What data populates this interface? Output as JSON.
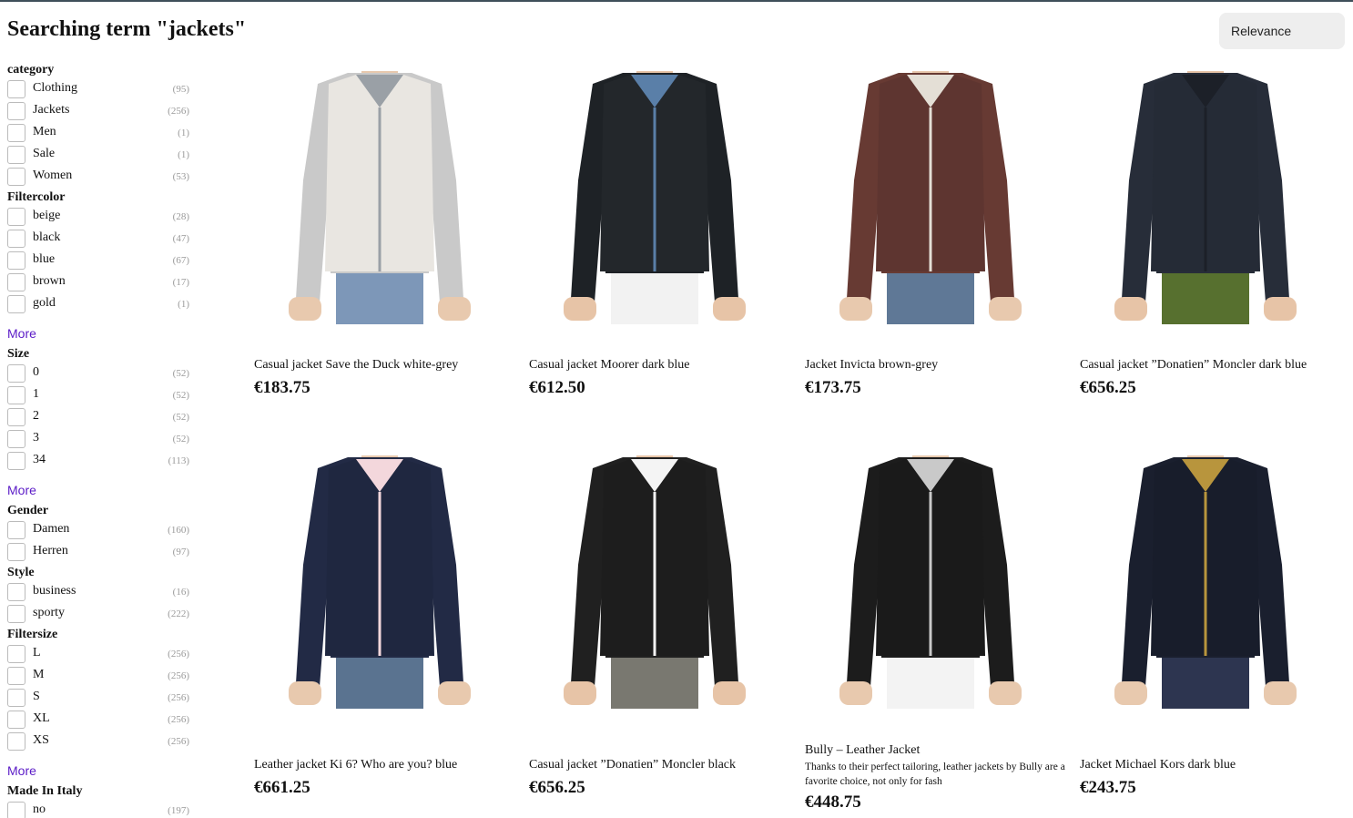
{
  "title": "Searching term \"jackets\"",
  "sort": {
    "selected": "Relevance"
  },
  "facets": [
    {
      "title": "category",
      "items": [
        {
          "label": "Clothing",
          "count": "(95)"
        },
        {
          "label": "Jackets",
          "count": "(256)"
        },
        {
          "label": "Men",
          "count": "(1)"
        },
        {
          "label": "Sale",
          "count": "(1)"
        },
        {
          "label": "Women",
          "count": "(53)"
        }
      ]
    },
    {
      "title": "Filtercolor",
      "items": [
        {
          "label": "beige",
          "count": "(28)"
        },
        {
          "label": "black",
          "count": "(47)"
        },
        {
          "label": "blue",
          "count": "(67)"
        },
        {
          "label": "brown",
          "count": "(17)"
        },
        {
          "label": "gold",
          "count": "(1)"
        }
      ],
      "more": "More"
    },
    {
      "title": "Size",
      "items": [
        {
          "label": "0",
          "count": "(52)"
        },
        {
          "label": "1",
          "count": "(52)"
        },
        {
          "label": "2",
          "count": "(52)"
        },
        {
          "label": "3",
          "count": "(52)"
        },
        {
          "label": "34",
          "count": "(113)"
        }
      ],
      "more": "More"
    },
    {
      "title": "Gender",
      "items": [
        {
          "label": "Damen",
          "count": "(160)"
        },
        {
          "label": "Herren",
          "count": "(97)"
        }
      ]
    },
    {
      "title": "Style",
      "items": [
        {
          "label": "business",
          "count": "(16)"
        },
        {
          "label": "sporty",
          "count": "(222)"
        }
      ]
    },
    {
      "title": "Filtersize",
      "items": [
        {
          "label": "L",
          "count": "(256)"
        },
        {
          "label": "M",
          "count": "(256)"
        },
        {
          "label": "S",
          "count": "(256)"
        },
        {
          "label": "XL",
          "count": "(256)"
        },
        {
          "label": "XS",
          "count": "(256)"
        }
      ],
      "more": "More"
    },
    {
      "title": "Made In Italy",
      "items": [
        {
          "label": "no",
          "count": "(197)"
        }
      ]
    }
  ],
  "products": [
    {
      "name": "Casual jacket Save the Duck white-grey",
      "price": "€183.75",
      "desc": "",
      "colors": {
        "body": "#e9e6e1",
        "sleeve": "#c9c9c9",
        "trim": "#9aa0a6",
        "pants": "#7d97b8",
        "skin": "#e8c9ae"
      }
    },
    {
      "name": "Casual jacket Moorer dark blue",
      "price": "€612.50",
      "desc": "",
      "colors": {
        "body": "#23272b",
        "sleeve": "#1e2226",
        "trim": "#5a7fa8",
        "pants": "#f2f2f2",
        "skin": "#e7c4a7"
      }
    },
    {
      "name": "Jacket Invicta brown-grey",
      "price": "€173.75",
      "desc": "",
      "colors": {
        "body": "#5e3530",
        "sleeve": "#673a33",
        "trim": "#e4dfd6",
        "pants": "#5f7896",
        "skin": "#e8c9ae"
      }
    },
    {
      "name": "Casual jacket ”Donatien” Moncler dark blue",
      "price": "€656.25",
      "desc": "",
      "colors": {
        "body": "#252b36",
        "sleeve": "#272d39",
        "trim": "#1c2028",
        "pants": "#57702f",
        "skin": "#e7c4a7"
      }
    },
    {
      "name": "Leather jacket Ki 6? Who are you? blue",
      "price": "€661.25",
      "desc": "",
      "colors": {
        "body": "#1f2740",
        "sleeve": "#222a45",
        "trim": "#f3d7dc",
        "pants": "#5a7390",
        "skin": "#e8c9ae"
      }
    },
    {
      "name": "Casual jacket ”Donatien” Moncler black",
      "price": "€656.25",
      "desc": "",
      "colors": {
        "body": "#1d1d1d",
        "sleeve": "#202020",
        "trim": "#f4f4f4",
        "pants": "#797870",
        "skin": "#e7c4a7"
      }
    },
    {
      "name": "Bully – Leather Jacket",
      "price": "€448.75",
      "desc": "Thanks to their perfect tailoring, leather jackets by Bully are a favorite choice, not only for fash",
      "colors": {
        "body": "#1a1a1a",
        "sleeve": "#1c1c1c",
        "trim": "#c9c9c9",
        "pants": "#f3f3f3",
        "skin": "#e8c9ae"
      }
    },
    {
      "name": "Jacket Michael Kors dark blue",
      "price": "€243.75",
      "desc": "",
      "colors": {
        "body": "#181d2b",
        "sleeve": "#1a1f2e",
        "trim": "#b8953d",
        "pants": "#2d3550",
        "skin": "#e8c9ae"
      }
    }
  ]
}
